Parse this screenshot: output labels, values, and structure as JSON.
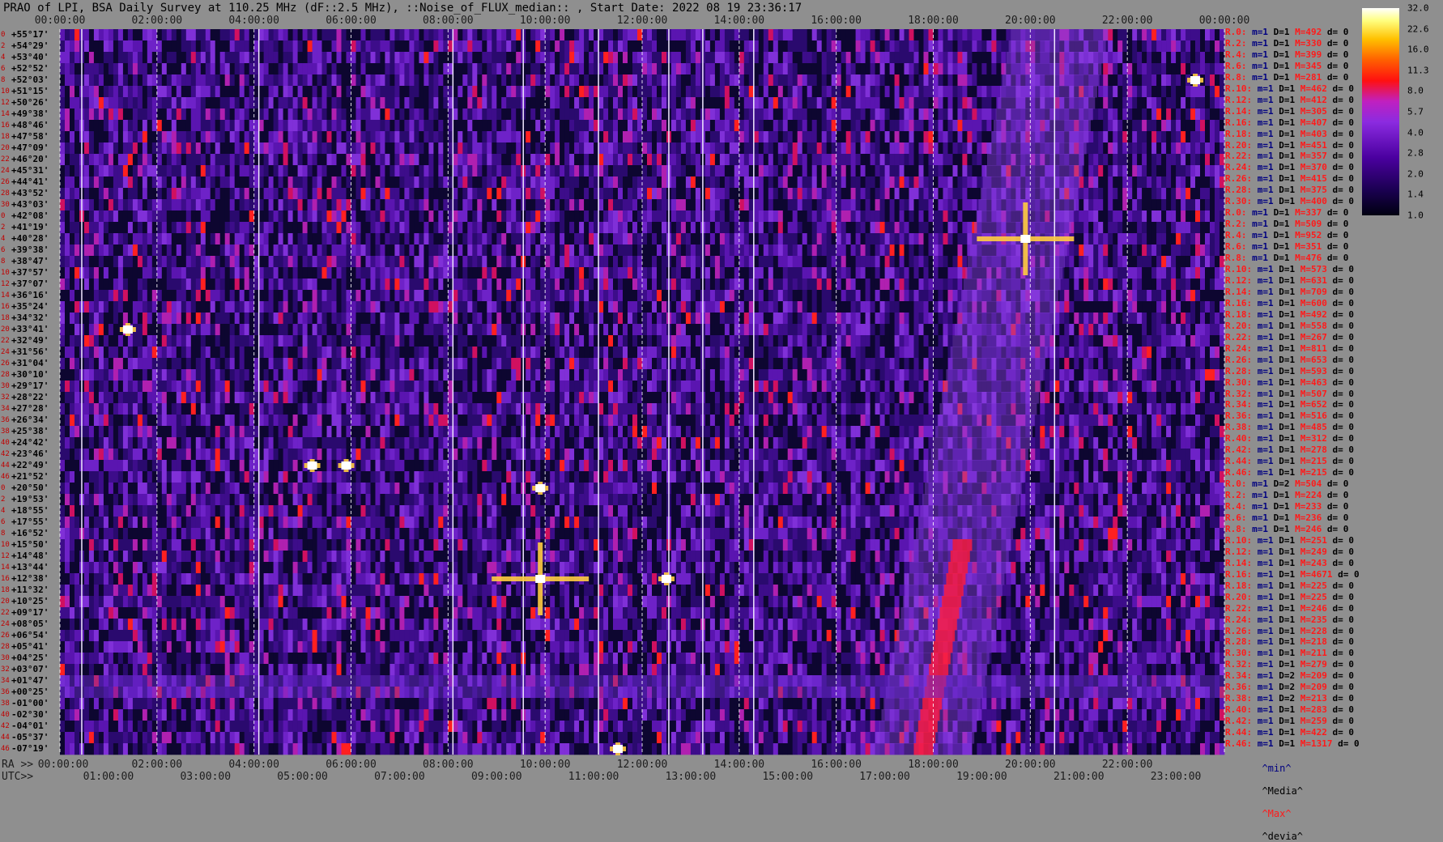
{
  "title": "PRAO of LPI, BSA Daily Survey at 110.25 MHz (dF::2.5 MHz), ::Noise_of_FLUX_median:: , Start Date: 2022 08 19 23:36:17",
  "chart_data": {
    "type": "heatmap",
    "top_time_ticks": [
      "00:00:00",
      "02:00:00",
      "04:00:00",
      "06:00:00",
      "08:00:00",
      "10:00:00",
      "12:00:00",
      "14:00:00",
      "16:00:00",
      "18:00:00",
      "20:00:00",
      "22:00:00",
      "00:00:00"
    ],
    "ra_label": "RA >>",
    "ra_ticks": [
      "00:00:00",
      "02:00:00",
      "04:00:00",
      "06:00:00",
      "08:00:00",
      "10:00:00",
      "12:00:00",
      "14:00:00",
      "16:00:00",
      "18:00:00",
      "20:00:00",
      "22:00:00"
    ],
    "utc_label": "UTC>>",
    "utc_ticks": [
      "01:00:00",
      "03:00:00",
      "05:00:00",
      "07:00:00",
      "09:00:00",
      "11:00:00",
      "13:00:00",
      "15:00:00",
      "17:00:00",
      "19:00:00",
      "21:00:00",
      "23:00:00"
    ],
    "declinations": [
      "+55°17'",
      "+54°29'",
      "+53°40'",
      "+52°52'",
      "+52°03'",
      "+51°15'",
      "+50°26'",
      "+49°38'",
      "+48°46'",
      "+47°58'",
      "+47°09'",
      "+46°20'",
      "+45°31'",
      "+44°41'",
      "+43°52'",
      "+43°03'",
      "+42°08'",
      "+41°19'",
      "+40°28'",
      "+39°38'",
      "+38°47'",
      "+37°57'",
      "+37°07'",
      "+36°16'",
      "+35°24'",
      "+34°32'",
      "+33°41'",
      "+32°49'",
      "+31°56'",
      "+31°04'",
      "+30°10'",
      "+29°17'",
      "+28°22'",
      "+27°28'",
      "+26°34'",
      "+25°38'",
      "+24°42'",
      "+23°46'",
      "+22°49'",
      "+21°52'",
      "+20°50'",
      "+19°53'",
      "+18°55'",
      "+17°55'",
      "+16°52'",
      "+15°50'",
      "+14°48'",
      "+13°44'",
      "+12°38'",
      "+11°32'",
      "+10°25'",
      "+09°17'",
      "+08°05'",
      "+06°54'",
      "+05°41'",
      "+04°25'",
      "+03°07'",
      "+01°47'",
      "+00°25'",
      "-01°00'",
      "-02°30'",
      "-04°01'",
      "-05°37'",
      "-07°19'"
    ],
    "row_indices": [
      "0",
      "2",
      "4",
      "6",
      "8",
      "10",
      "12",
      "14",
      "16",
      "18",
      "20",
      "22",
      "24",
      "26",
      "28",
      "30",
      "0",
      "2",
      "4",
      "6",
      "8",
      "10",
      "12",
      "14",
      "16",
      "18",
      "20",
      "22",
      "24",
      "26",
      "28",
      "30",
      "32",
      "34",
      "36",
      "38",
      "40",
      "42",
      "44",
      "46",
      "0",
      "2",
      "4",
      "6",
      "8",
      "10",
      "12",
      "14",
      "16",
      "18",
      "20",
      "22",
      "24",
      "26",
      "28",
      "30",
      "32",
      "34",
      "36",
      "38",
      "40",
      "42",
      "44",
      "46"
    ],
    "stats": [
      {
        "r": "R.0:",
        "m": "1",
        "d": "1",
        "n": "492",
        "dv": "0"
      },
      {
        "r": "R.2:",
        "m": "1",
        "d": "1",
        "n": "330",
        "dv": "0"
      },
      {
        "r": "R.4:",
        "m": "1",
        "d": "1",
        "n": "399",
        "dv": "0"
      },
      {
        "r": "R.6:",
        "m": "1",
        "d": "1",
        "n": "345",
        "dv": "0"
      },
      {
        "r": "R.8:",
        "m": "1",
        "d": "1",
        "n": "281",
        "dv": "0"
      },
      {
        "r": "R.10:",
        "m": "1",
        "d": "1",
        "n": "462",
        "dv": "0"
      },
      {
        "r": "R.12:",
        "m": "1",
        "d": "1",
        "n": "412",
        "dv": "0"
      },
      {
        "r": "R.14:",
        "m": "1",
        "d": "1",
        "n": "305",
        "dv": "0"
      },
      {
        "r": "R.16:",
        "m": "1",
        "d": "1",
        "n": "407",
        "dv": "0"
      },
      {
        "r": "R.18:",
        "m": "1",
        "d": "1",
        "n": "403",
        "dv": "0"
      },
      {
        "r": "R.20:",
        "m": "1",
        "d": "1",
        "n": "451",
        "dv": "0"
      },
      {
        "r": "R.22:",
        "m": "1",
        "d": "1",
        "n": "357",
        "dv": "0"
      },
      {
        "r": "R.24:",
        "m": "1",
        "d": "1",
        "n": "370",
        "dv": "0"
      },
      {
        "r": "R.26:",
        "m": "1",
        "d": "1",
        "n": "415",
        "dv": "0"
      },
      {
        "r": "R.28:",
        "m": "1",
        "d": "1",
        "n": "375",
        "dv": "0"
      },
      {
        "r": "R.30:",
        "m": "1",
        "d": "1",
        "n": "400",
        "dv": "0"
      },
      {
        "r": "R.0:",
        "m": "1",
        "d": "1",
        "n": "337",
        "dv": "0"
      },
      {
        "r": "R.2:",
        "m": "1",
        "d": "1",
        "n": "509",
        "dv": "0"
      },
      {
        "r": "R.4:",
        "m": "1",
        "d": "1",
        "n": "952",
        "dv": "0"
      },
      {
        "r": "R.6:",
        "m": "1",
        "d": "1",
        "n": "351",
        "dv": "0"
      },
      {
        "r": "R.8:",
        "m": "1",
        "d": "1",
        "n": "476",
        "dv": "0"
      },
      {
        "r": "R.10:",
        "m": "1",
        "d": "1",
        "n": "573",
        "dv": "0"
      },
      {
        "r": "R.12:",
        "m": "1",
        "d": "1",
        "n": "631",
        "dv": "0"
      },
      {
        "r": "R.14:",
        "m": "1",
        "d": "1",
        "n": "709",
        "dv": "0"
      },
      {
        "r": "R.16:",
        "m": "1",
        "d": "1",
        "n": "600",
        "dv": "0"
      },
      {
        "r": "R.18:",
        "m": "1",
        "d": "1",
        "n": "492",
        "dv": "0"
      },
      {
        "r": "R.20:",
        "m": "1",
        "d": "1",
        "n": "558",
        "dv": "0"
      },
      {
        "r": "R.22:",
        "m": "1",
        "d": "1",
        "n": "267",
        "dv": "0"
      },
      {
        "r": "R.24:",
        "m": "1",
        "d": "1",
        "n": "811",
        "dv": "0"
      },
      {
        "r": "R.26:",
        "m": "1",
        "d": "1",
        "n": "653",
        "dv": "0"
      },
      {
        "r": "R.28:",
        "m": "1",
        "d": "1",
        "n": "593",
        "dv": "0"
      },
      {
        "r": "R.30:",
        "m": "1",
        "d": "1",
        "n": "463",
        "dv": "0"
      },
      {
        "r": "R.32:",
        "m": "1",
        "d": "1",
        "n": "507",
        "dv": "0"
      },
      {
        "r": "R.34:",
        "m": "1",
        "d": "1",
        "n": "652",
        "dv": "0"
      },
      {
        "r": "R.36:",
        "m": "1",
        "d": "1",
        "n": "516",
        "dv": "0"
      },
      {
        "r": "R.38:",
        "m": "1",
        "d": "1",
        "n": "485",
        "dv": "0"
      },
      {
        "r": "R.40:",
        "m": "1",
        "d": "1",
        "n": "312",
        "dv": "0"
      },
      {
        "r": "R.42:",
        "m": "1",
        "d": "1",
        "n": "278",
        "dv": "0"
      },
      {
        "r": "R.44:",
        "m": "1",
        "d": "1",
        "n": "215",
        "dv": "0"
      },
      {
        "r": "R.46:",
        "m": "1",
        "d": "1",
        "n": "215",
        "dv": "0"
      },
      {
        "r": "R.0:",
        "m": "1",
        "d": "2",
        "n": "504",
        "dv": "0"
      },
      {
        "r": "R.2:",
        "m": "1",
        "d": "1",
        "n": "224",
        "dv": "0"
      },
      {
        "r": "R.4:",
        "m": "1",
        "d": "1",
        "n": "233",
        "dv": "0"
      },
      {
        "r": "R.6:",
        "m": "1",
        "d": "1",
        "n": "236",
        "dv": "0"
      },
      {
        "r": "R.8:",
        "m": "1",
        "d": "1",
        "n": "246",
        "dv": "0"
      },
      {
        "r": "R.10:",
        "m": "1",
        "d": "1",
        "n": "251",
        "dv": "0"
      },
      {
        "r": "R.12:",
        "m": "1",
        "d": "1",
        "n": "249",
        "dv": "0"
      },
      {
        "r": "R.14:",
        "m": "1",
        "d": "1",
        "n": "243",
        "dv": "0"
      },
      {
        "r": "R.16:",
        "m": "1",
        "d": "1",
        "n": "4671",
        "dv": "0"
      },
      {
        "r": "R.18:",
        "m": "1",
        "d": "1",
        "n": "225",
        "dv": "0"
      },
      {
        "r": "R.20:",
        "m": "1",
        "d": "1",
        "n": "225",
        "dv": "0"
      },
      {
        "r": "R.22:",
        "m": "1",
        "d": "1",
        "n": "246",
        "dv": "0"
      },
      {
        "r": "R.24:",
        "m": "1",
        "d": "1",
        "n": "235",
        "dv": "0"
      },
      {
        "r": "R.26:",
        "m": "1",
        "d": "1",
        "n": "228",
        "dv": "0"
      },
      {
        "r": "R.28:",
        "m": "1",
        "d": "1",
        "n": "218",
        "dv": "0"
      },
      {
        "r": "R.30:",
        "m": "1",
        "d": "1",
        "n": "211",
        "dv": "0"
      },
      {
        "r": "R.32:",
        "m": "1",
        "d": "1",
        "n": "279",
        "dv": "0"
      },
      {
        "r": "R.34:",
        "m": "1",
        "d": "2",
        "n": "209",
        "dv": "0"
      },
      {
        "r": "R.36:",
        "m": "1",
        "d": "2",
        "n": "209",
        "dv": "0"
      },
      {
        "r": "R.38:",
        "m": "1",
        "d": "2",
        "n": "213",
        "dv": "0"
      },
      {
        "r": "R.40:",
        "m": "1",
        "d": "1",
        "n": "283",
        "dv": "0"
      },
      {
        "r": "R.42:",
        "m": "1",
        "d": "1",
        "n": "259",
        "dv": "0"
      },
      {
        "r": "R.44:",
        "m": "1",
        "d": "1",
        "n": "422",
        "dv": "0"
      },
      {
        "r": "R.46:",
        "m": "1",
        "d": "1",
        "n": "1317",
        "dv": "0"
      }
    ],
    "legend": {
      "min": "^min^",
      "median": "^Media^",
      "max": "^Max^",
      "devia": "^devia^"
    },
    "colorbar_ticks": [
      "32.0",
      "22.6",
      "16.0",
      "11.3",
      "8.0",
      "5.7",
      "4.0",
      "2.8",
      "2.0",
      "1.4",
      "1.0"
    ],
    "colormap": [
      "#000010",
      "#1a0050",
      "#4b00a0",
      "#8b2be0",
      "#c020c0",
      "#ff1010",
      "#ff6000",
      "#ffc000",
      "#ffff80",
      "#ffffff"
    ],
    "bright_sources": [
      {
        "ra_h": 9.9,
        "dec_row": 48,
        "level": 32
      },
      {
        "ra_h": 19.9,
        "dec_row": 18,
        "level": 32
      },
      {
        "ra_h": 11.5,
        "dec_row": 63,
        "level": 22.6
      },
      {
        "ra_h": 12.5,
        "dec_row": 48,
        "level": 16
      },
      {
        "ra_h": 23.4,
        "dec_row": 4,
        "level": 22.6
      },
      {
        "ra_h": 9.9,
        "dec_row": 40,
        "level": 22.6
      },
      {
        "ra_h": 1.4,
        "dec_row": 26,
        "level": 16
      },
      {
        "ra_h": 5.2,
        "dec_row": 38,
        "level": 16
      },
      {
        "ra_h": 5.9,
        "dec_row": 38,
        "level": 16
      }
    ],
    "track": {
      "label_free": true,
      "ra_start_h": 17.8,
      "ra_end_h": 20.6,
      "dec_row_start": 63,
      "dec_row_end": 0
    }
  }
}
